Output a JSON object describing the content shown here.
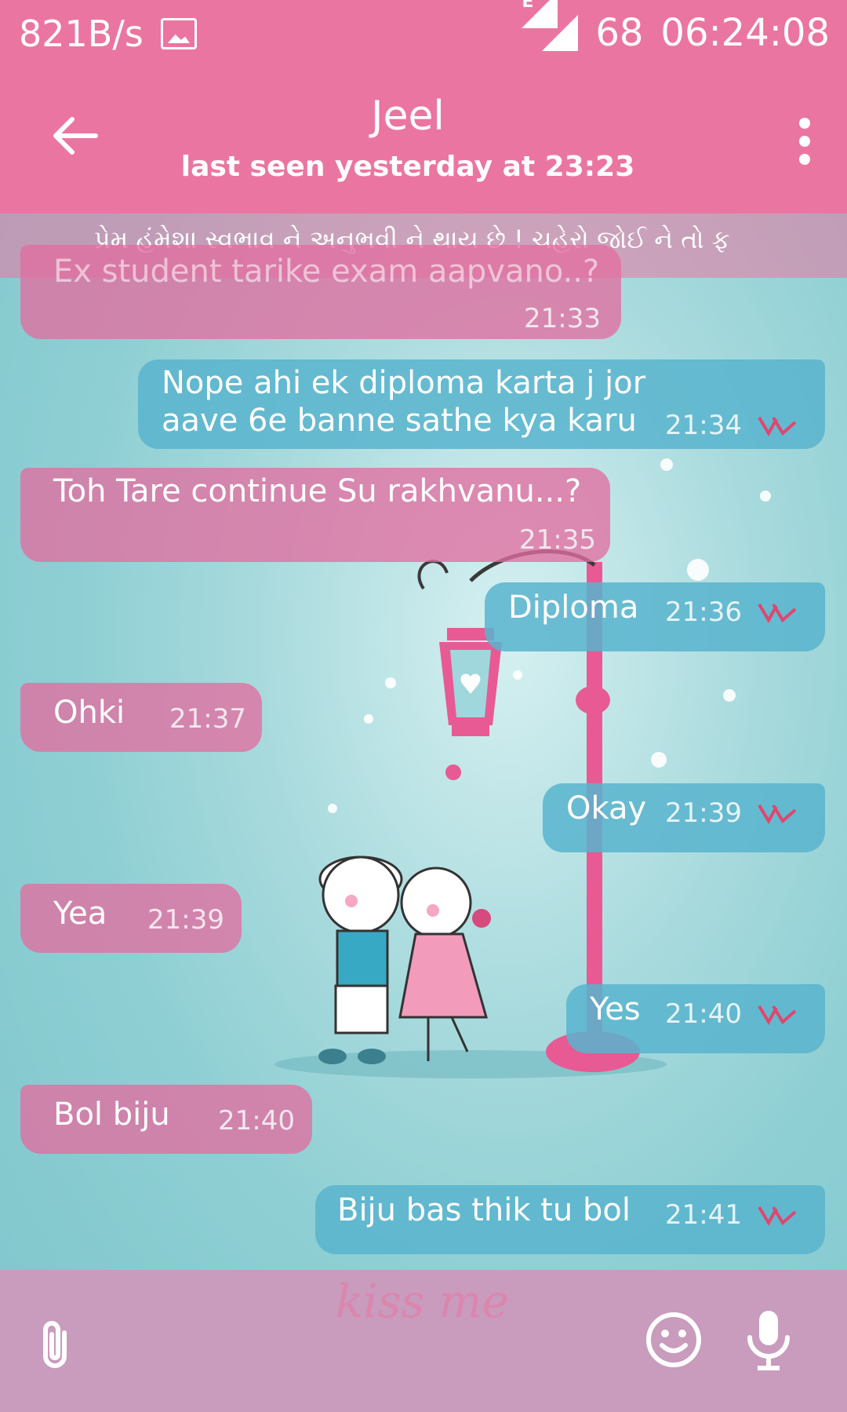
{
  "status_bar": {
    "net_speed": "821B/s",
    "network_letter": "E",
    "battery": "68",
    "time": "06:24:08"
  },
  "header": {
    "contact_name": "Jeel",
    "last_seen": "last seen yesterday at 23:23"
  },
  "banner": {
    "text": "પ્રેમ હંમેશા સ્વભાવ ને અનુભવી ને થાય છે ! ચહેરો જોઈ ને તો ફ"
  },
  "messages": [
    {
      "dir": "in",
      "text": "Ex student tarike exam aapvano..?",
      "time": "21:33"
    },
    {
      "dir": "out",
      "text": "Nope ahi ek diploma karta j jor aave 6e banne sathe kya karu",
      "time": "21:34"
    },
    {
      "dir": "in",
      "text": "Toh Tare continue Su rakhvanu...?",
      "time": "21:35"
    },
    {
      "dir": "out",
      "text": "Diploma",
      "time": "21:36"
    },
    {
      "dir": "in",
      "text": "Ohki",
      "time": "21:37"
    },
    {
      "dir": "out",
      "text": "Okay",
      "time": "21:39"
    },
    {
      "dir": "in",
      "text": "Yea",
      "time": "21:39"
    },
    {
      "dir": "out",
      "text": "Yes",
      "time": "21:40"
    },
    {
      "dir": "in",
      "text": "Bol biju",
      "time": "21:40"
    },
    {
      "dir": "out",
      "text": "Biju bas thik tu bol",
      "time": "21:41"
    }
  ],
  "input_bar": {
    "wallpaper_text": "kiss me",
    "icons": [
      "attach-icon",
      "emoji-icon",
      "mic-icon"
    ]
  },
  "colors": {
    "header": "#eb75a1",
    "incoming_bubble": "#e26ea0",
    "outgoing_bubble": "#58b4ce",
    "read_ticks": "#e0466f",
    "input_bar": "#c99bbd"
  }
}
